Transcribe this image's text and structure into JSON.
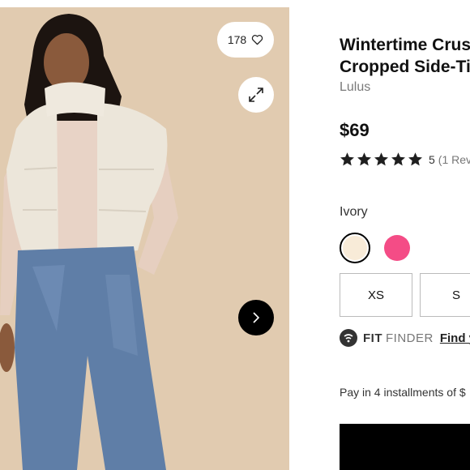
{
  "product": {
    "title_line1": "Wintertime Crus",
    "title_line2": "Cropped Side-Ti",
    "brand": "Lulus",
    "price": "$69",
    "rating": {
      "stars": 5,
      "count": "5",
      "reviews_text": "(1 Rev"
    }
  },
  "gallery": {
    "favorites_count": "178",
    "icons": {
      "favorite": "heart-outline-icon",
      "expand": "expand-arrows-icon",
      "next": "chevron-right-icon"
    }
  },
  "color": {
    "selected_label": "Ivory",
    "swatches": [
      {
        "name": "ivory",
        "hex": "#f8ebd8"
      },
      {
        "name": "pink",
        "hex": "#f44c86"
      }
    ]
  },
  "sizes": [
    "XS",
    "S"
  ],
  "fit_finder": {
    "brand_bold": "FIT",
    "brand_light": "FINDER",
    "link": "Find y"
  },
  "payment": {
    "installments_text": "Pay in 4 installments of $"
  },
  "colors": {
    "star": "#1f1f1f",
    "photo_bg": "#e1cbb0",
    "button_black": "#000000"
  }
}
